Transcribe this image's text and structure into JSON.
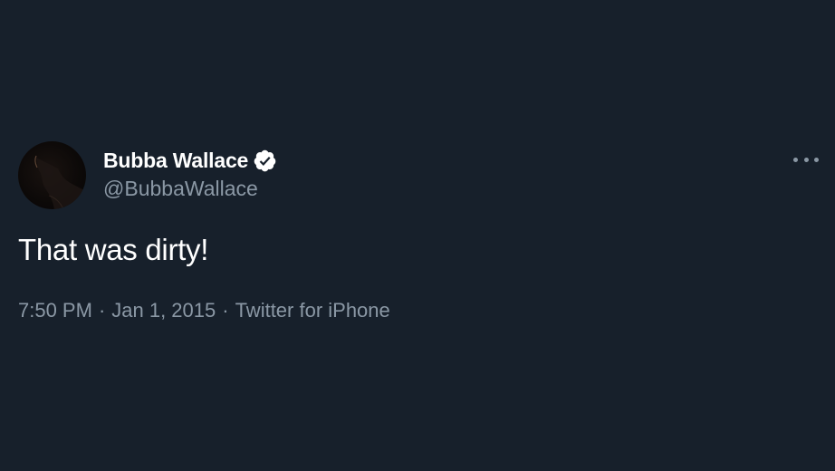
{
  "tweet": {
    "author": {
      "display_name": "Bubba Wallace",
      "handle": "@BubbaWallace",
      "verified": true
    },
    "text": "That was dirty!",
    "time": "7:50 PM",
    "date": "Jan 1, 2015",
    "source": "Twitter for iPhone",
    "separator": "·"
  },
  "icons": {
    "verified": "verified-badge-icon",
    "more": "more-options-icon"
  },
  "colors": {
    "background": "#17202b",
    "primary_text": "#ffffff",
    "secondary_text": "#8b98a5"
  }
}
